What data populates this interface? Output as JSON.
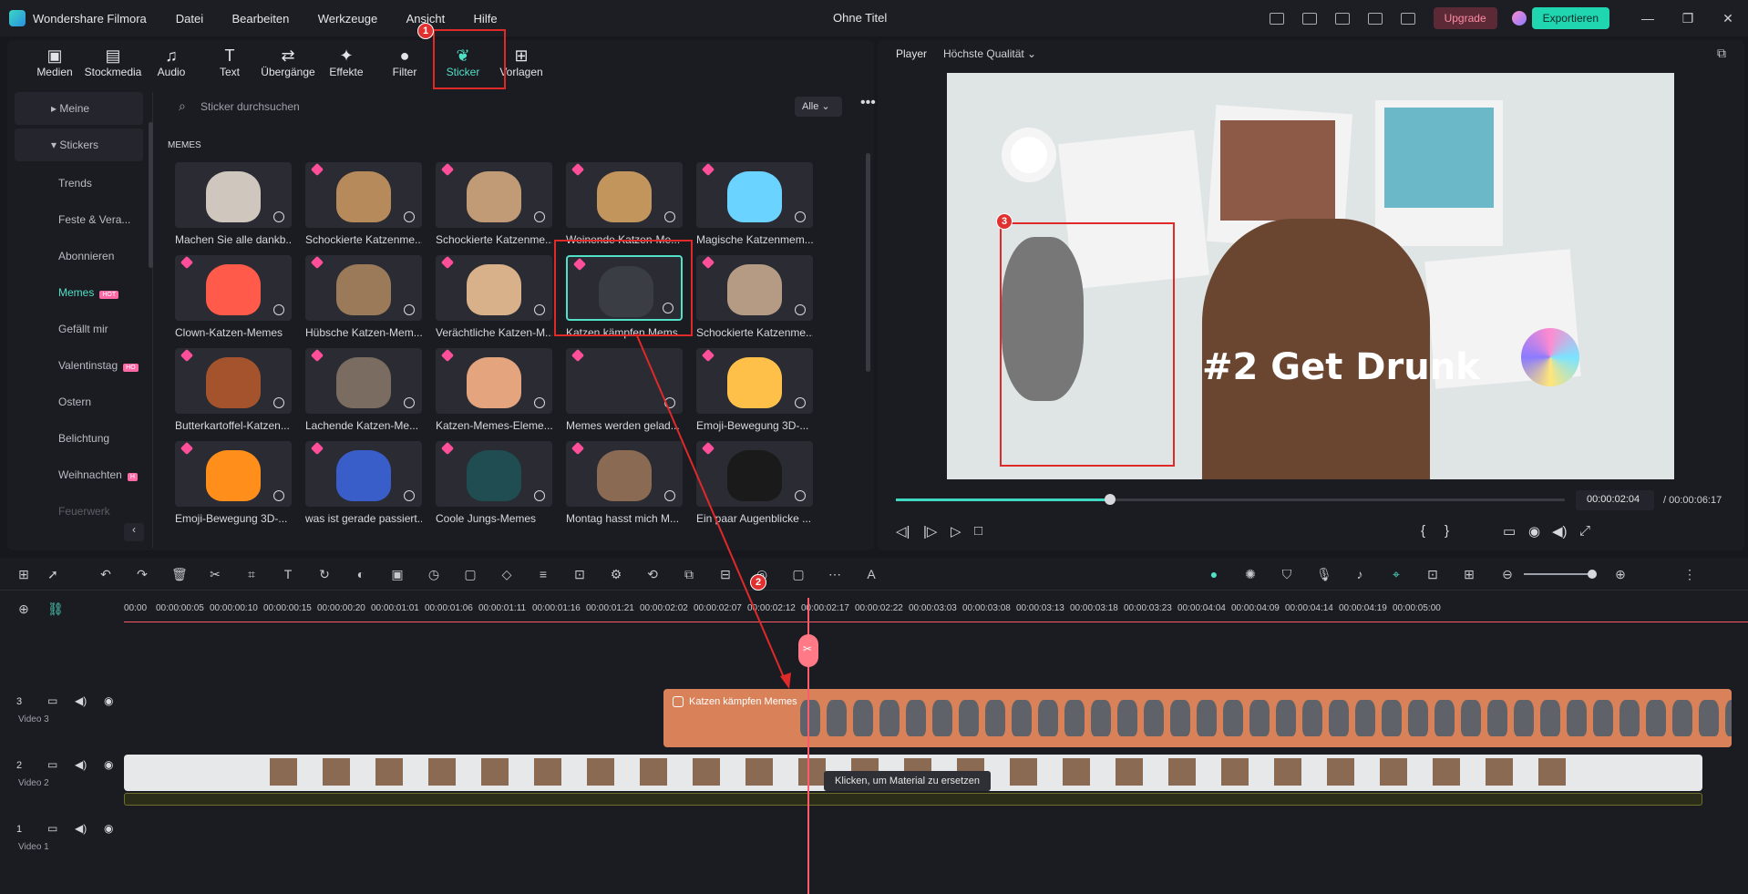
{
  "app": {
    "name": "Wondershare Filmora",
    "menu": [
      "Datei",
      "Bearbeiten",
      "Werkzeuge",
      "Ansicht",
      "Hilfe"
    ],
    "file_title": "Ohne Titel",
    "upgrade": "Upgrade",
    "export": "Exportieren"
  },
  "tabs": [
    {
      "label": "Medien",
      "icon": "image-icon"
    },
    {
      "label": "Stockmedia",
      "icon": "cloud-folder-icon"
    },
    {
      "label": "Audio",
      "icon": "music-note-icon"
    },
    {
      "label": "Text",
      "icon": "text-t-icon"
    },
    {
      "label": "Übergänge",
      "icon": "transition-icon"
    },
    {
      "label": "Effekte",
      "icon": "sparkle-icon"
    },
    {
      "label": "Filter",
      "icon": "filter-icon"
    },
    {
      "label": "Sticker",
      "icon": "sticker-icon"
    },
    {
      "label": "Vorlagen",
      "icon": "template-icon"
    }
  ],
  "sidebar": {
    "top": [
      {
        "label": "Meine"
      },
      {
        "label": "Stickers"
      }
    ],
    "items": [
      {
        "label": "Trends"
      },
      {
        "label": "Feste & Vera..."
      },
      {
        "label": "Abonnieren"
      },
      {
        "label": "Memes",
        "badge": "HOT"
      },
      {
        "label": "Gefällt mir"
      },
      {
        "label": "Valentinstag",
        "badge": "HO"
      },
      {
        "label": "Ostern"
      },
      {
        "label": "Belichtung"
      },
      {
        "label": "Weihnachten",
        "badge": "H"
      },
      {
        "label": "Feuerwerk"
      }
    ]
  },
  "search": {
    "placeholder": "Sticker durchsuchen",
    "filter": "Alle"
  },
  "section": "MEMES",
  "stickers": [
    [
      "Machen Sie alle dankb...",
      "Schockierte Katzenme...",
      "Schockierte Katzenme...",
      "Weinende Katzen-Me...",
      "Magische Katzenmem..."
    ],
    [
      "Clown-Katzen-Memes",
      "Hübsche Katzen-Mem...",
      "Verächtliche Katzen-M...",
      "Katzen kämpfen Mems",
      "Schockierte Katzenme..."
    ],
    [
      "Butterkartoffel-Katzen...",
      "Lachende Katzen-Me...",
      "Katzen-Memes-Eleme...",
      "Memes werden gelad...",
      "Emoji-Bewegung 3D-..."
    ],
    [
      "Emoji-Bewegung 3D-...",
      "was ist gerade passiert...",
      "Coole Jungs-Memes",
      "Montag hasst mich M...",
      "Ein paar Augenblicke ..."
    ]
  ],
  "player": {
    "label": "Player",
    "quality": "Höchste Qualität",
    "overlay_text": "#2 Get Drunk",
    "current": "00:00:02:04",
    "total": "/ 00:00:06:17",
    "progress": 0.32
  },
  "ruler": [
    "00:00",
    "00:00:00:05",
    "00:00:00:10",
    "00:00:00:15",
    "00:00:00:20",
    "00:00:01:01",
    "00:00:01:06",
    "00:00:01:11",
    "00:00:01:16",
    "00:00:01:21",
    "00:00:02:02",
    "00:00:02:07",
    "00:00:02:12",
    "00:00:02:17",
    "00:00:02:22",
    "00:00:03:03",
    "00:00:03:08",
    "00:00:03:13",
    "00:00:03:18",
    "00:00:03:23",
    "00:00:04:04",
    "00:00:04:09",
    "00:00:04:14",
    "00:00:04:19",
    "00:00:05:00"
  ],
  "tracks": [
    {
      "num": "3",
      "name": "Video 3"
    },
    {
      "num": "2",
      "name": "Video 2"
    },
    {
      "num": "1",
      "name": "Video 1"
    }
  ],
  "clip3_label": "Katzen kämpfen Memes",
  "tooltip": "Klicken, um Material zu ersetzen",
  "markers": [
    "1",
    "2",
    "3"
  ],
  "colors": {
    "accent": "#20d6b0",
    "clip": "#d9825a",
    "playhead": "#ff5a6c",
    "callout": "#e02929"
  }
}
